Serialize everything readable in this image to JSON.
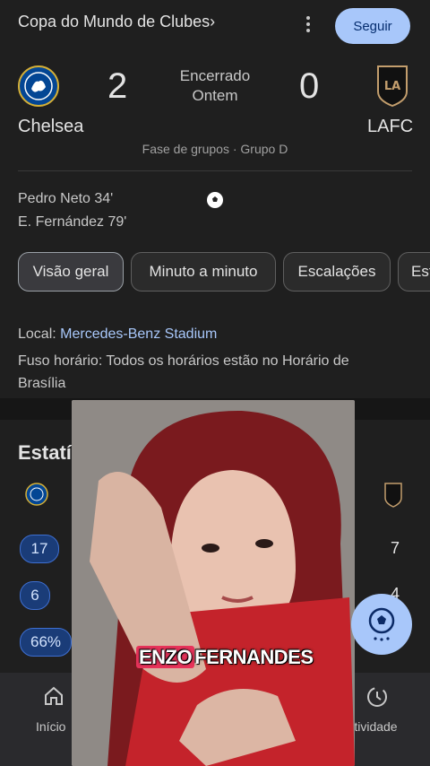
{
  "header": {
    "competition": "Copa do Mundo de Clubes",
    "chevron": "›",
    "follow_label": "Seguir"
  },
  "match": {
    "home": {
      "name": "Chelsea",
      "score": "2"
    },
    "away": {
      "name": "LAFC",
      "score": "0"
    },
    "status_line1": "Encerrado",
    "status_line2": "Ontem",
    "stage": "Fase de grupos · Grupo D",
    "scorers": [
      "Pedro Neto 34'",
      "E. Fernández 79'"
    ]
  },
  "tabs": [
    {
      "label": "Visão geral",
      "active": true
    },
    {
      "label": "Minuto a minuto",
      "active": false
    },
    {
      "label": "Escalações",
      "active": false
    },
    {
      "label": "Est",
      "active": false
    }
  ],
  "info": {
    "venue_label": "Local:",
    "venue_value": "Mercedes-Benz Stadium",
    "timezone_label": "Fuso horário:",
    "timezone_value": "Todos os horários estão no Horário de Brasília"
  },
  "stats": {
    "title": "Estatísticas da p",
    "rows": [
      {
        "home": "17",
        "away": "7"
      },
      {
        "home": "6",
        "away": "4"
      },
      {
        "home": "66%",
        "away": ""
      }
    ]
  },
  "bottom_nav": {
    "home_label": "Início",
    "activity_label": "Atividade"
  },
  "overlay": {
    "caption_highlight": "ENZO",
    "caption_rest": "FERNANDES"
  },
  "colors": {
    "background": "#1f1f1f",
    "accent": "#a8c7fa",
    "pill": "#1a3c78",
    "chelsea_blue": "#034694",
    "lafc_gold": "#c39e6d"
  }
}
